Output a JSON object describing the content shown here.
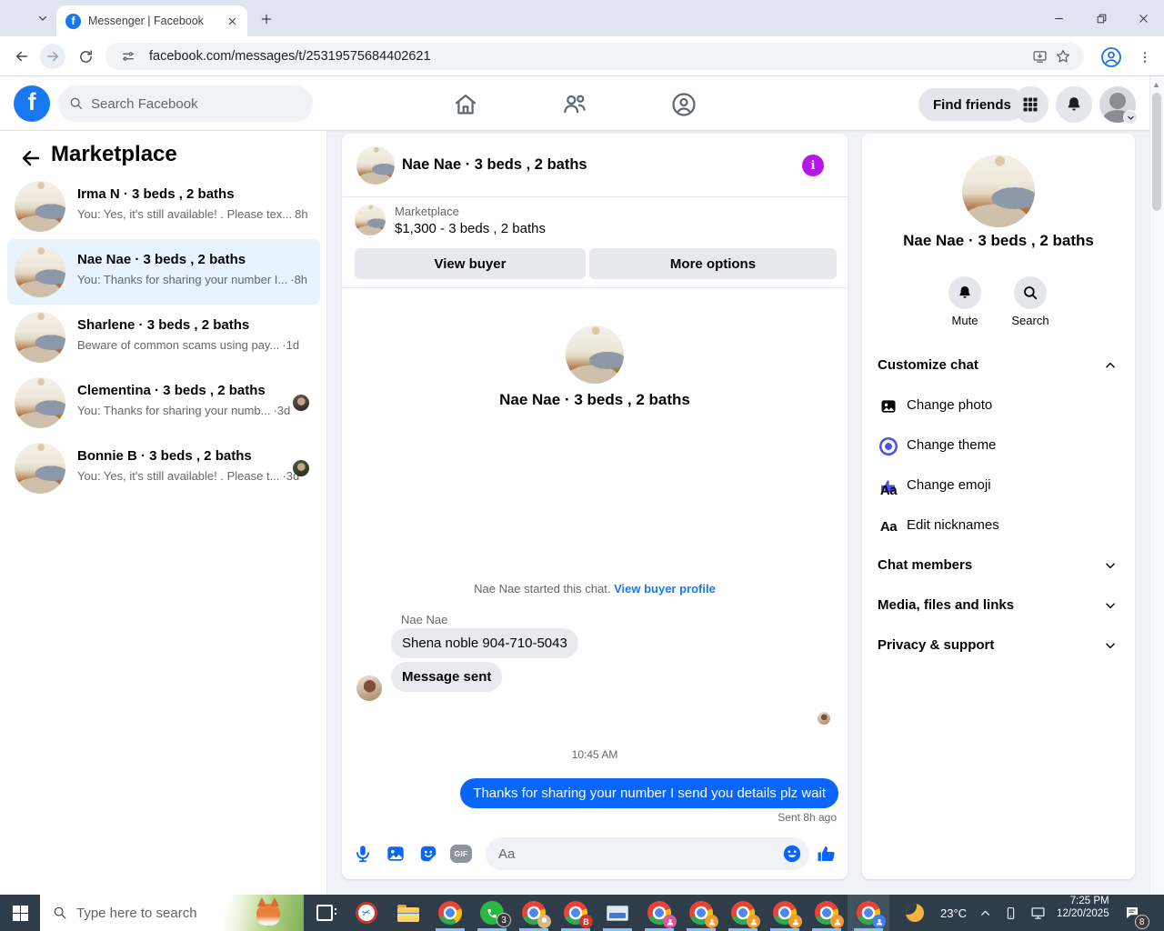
{
  "browser": {
    "tab_title": "Messenger | Facebook",
    "url": "facebook.com/messages/t/25319575684402621"
  },
  "header": {
    "logo_letter": "f",
    "search_placeholder": "Search Facebook",
    "find_friends_label": "Find friends"
  },
  "sidebar": {
    "title": "Marketplace",
    "conversations": [
      {
        "name": "Irma N · 3 beds , 2 baths",
        "preview": "You: Yes, it's still available! . Please tex...",
        "time": "8h"
      },
      {
        "name": "Nae Nae · 3 beds , 2 baths",
        "preview": "You: Thanks for sharing your number I...",
        "time": "·8h"
      },
      {
        "name": "Sharlene · 3 beds , 2 baths",
        "preview": "Beware of common scams using pay...",
        "time": "·1d"
      },
      {
        "name": "Clementina · 3 beds , 2 baths",
        "preview": "You: Thanks for sharing your numb...",
        "time": "·3d"
      },
      {
        "name": "Bonnie B · 3 beds , 2 baths",
        "preview": "You: Yes, it's still available! . Please t...",
        "time": "·3d"
      }
    ]
  },
  "chat": {
    "name": "Nae Nae · 3 beds , 2 baths",
    "banner": {
      "source": "Marketplace",
      "listing": "$1,300 - 3 beds , 2 baths",
      "view_buyer": "View buyer",
      "more_options": "More options"
    },
    "intro_name": "Nae Nae · 3 beds , 2 baths",
    "started_text": "Nae Nae started this chat.",
    "buyer_profile_link": "View buyer profile",
    "sender": "Nae Nae",
    "incoming": [
      "Shena noble 904-710-5043",
      "Message sent"
    ],
    "time_divider": "10:45 AM",
    "outgoing": "Thanks for sharing your number I send you details plz wait",
    "sent_status": "Sent 8h ago",
    "composer_placeholder": "Aa",
    "gif_label": "GIF"
  },
  "panel": {
    "name": "Nae Nae · 3 beds , 2 baths",
    "mute_label": "Mute",
    "search_label": "Search",
    "customize_title": "Customize chat",
    "options": [
      "Change photo",
      "Change theme",
      "Change emoji",
      "Edit nicknames"
    ],
    "aa_icon": "Aa",
    "sections": [
      "Chat members",
      "Media, files and links",
      "Privacy & support"
    ]
  },
  "taskbar": {
    "search_placeholder": "Type here to search",
    "whatsapp_badge": "3",
    "chrome_badge_letter": "B",
    "temperature": "23°C",
    "time": "7:25 PM",
    "date": "12/20/2025",
    "notification_badge": "8"
  },
  "colors": {
    "messenger_blue": "#0866ff",
    "facebook_blue": "#1877f2",
    "info_purple": "#b517e8",
    "theme_blue": "#4a52f0",
    "selected_row": "#e7f3ff"
  }
}
